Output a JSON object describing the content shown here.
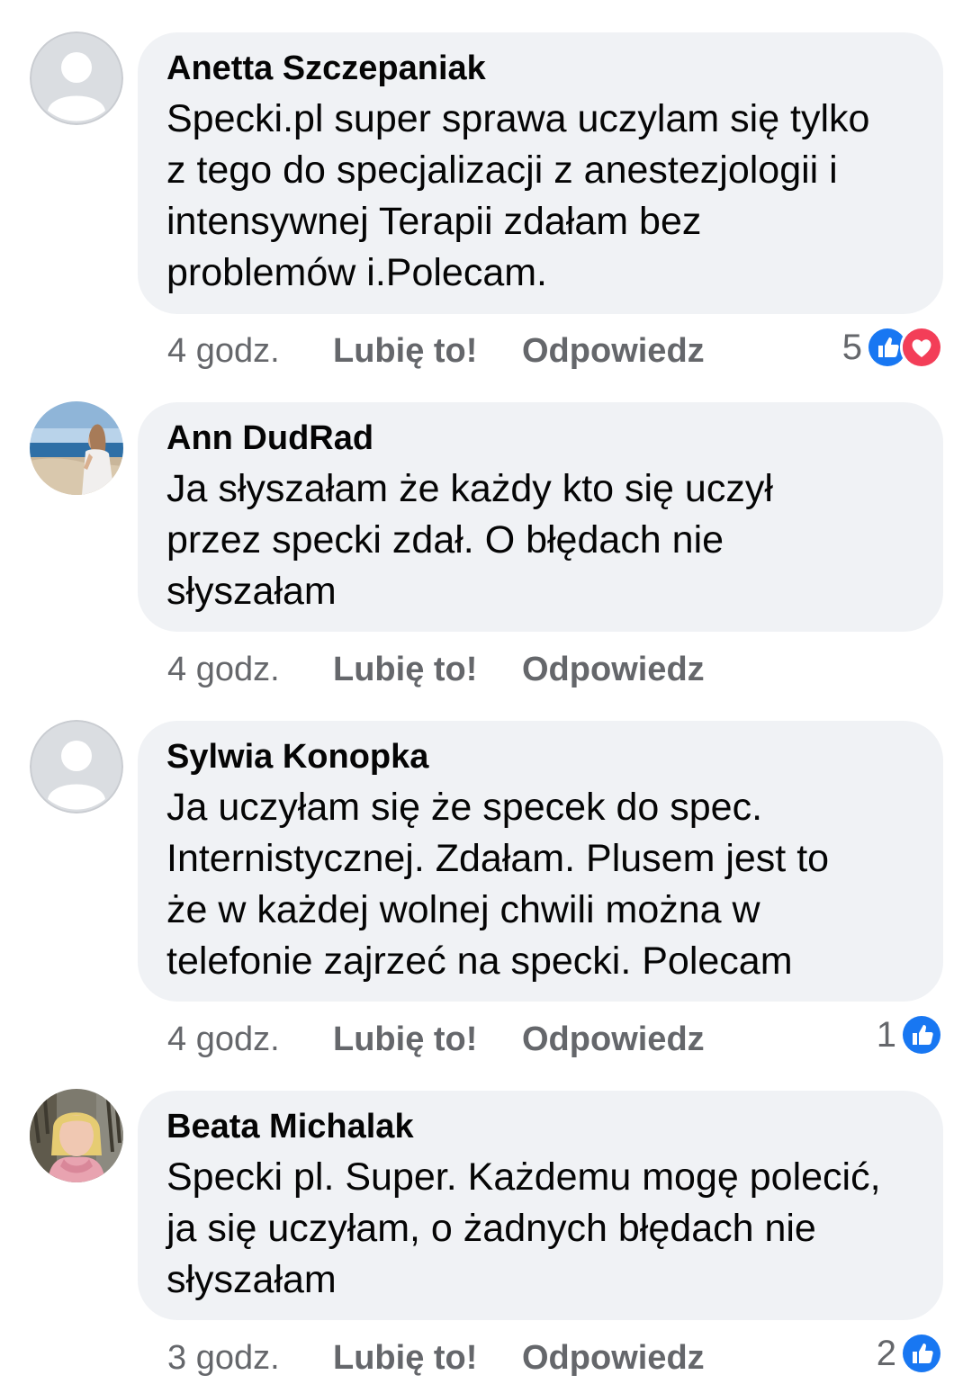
{
  "comments": [
    {
      "author": "Anetta Szczepaniak",
      "text": "Specki.pl super sprawa uczylam się tylko\nz tego do specjalizacji z anestezjologii i\nintensywnej Terapii zdałam bez\nproblemów i.Polecam.",
      "time": "4 godz.",
      "like_label": "Lubię to!",
      "reply_label": "Odpowiedz",
      "reaction_count": "5",
      "reactions": [
        "like-icon",
        "love-icon"
      ],
      "avatar": "default-avatar"
    },
    {
      "author": "Ann DudRad",
      "text": "Ja słyszałam że każdy kto się uczył\nprzez specki zdał. O błędach nie\nsłyszałam",
      "time": "4 godz.",
      "like_label": "Lubię to!",
      "reply_label": "Odpowiedz",
      "reaction_count": "",
      "reactions": [],
      "avatar": "beach-photo-avatar"
    },
    {
      "author": "Sylwia Konopka",
      "text": "Ja uczyłam się że specek do spec.\nInternistycznej. Zdałam. Plusem jest to\nże w każdej wolnej chwili można w\ntelefonie zajrzeć na specki. Polecam",
      "time": "4 godz.",
      "like_label": "Lubię to!",
      "reply_label": "Odpowiedz",
      "reaction_count": "1",
      "reactions": [
        "like-icon"
      ],
      "avatar": "default-avatar"
    },
    {
      "author": "Beata Michalak",
      "text": "Specki pl. Super. Każdemu mogę polecić,\nja się uczyłam, o  żadnych błędach nie\nsłyszałam",
      "time": "3 godz.",
      "like_label": "Lubię to!",
      "reply_label": "Odpowiedz",
      "reaction_count": "2",
      "reactions": [
        "like-icon"
      ],
      "avatar": "portrait-photo-avatar"
    }
  ],
  "colors": {
    "bubble_bg": "#f0f2f5",
    "text": "#050505",
    "secondary_text": "#65676b",
    "like_blue": "#1877f2",
    "love_red": "#f33e58"
  }
}
